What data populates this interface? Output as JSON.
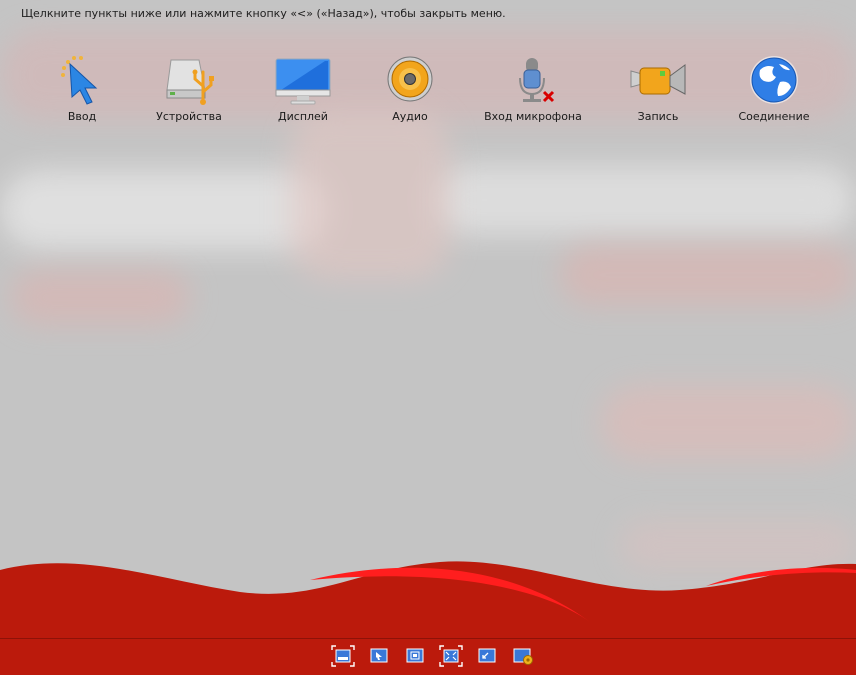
{
  "hint": "Щелкните пункты ниже или нажмите кнопку «<» («Назад»), чтобы закрыть меню.",
  "menu": {
    "items": [
      {
        "label": "Ввод",
        "icon": "pointer-cursor-icon"
      },
      {
        "label": "Устройства",
        "icon": "usb-drive-icon"
      },
      {
        "label": "Дисплей",
        "icon": "monitor-icon"
      },
      {
        "label": "Аудио",
        "icon": "speaker-icon"
      },
      {
        "label": "Вход микрофона",
        "icon": "microphone-muted-icon"
      },
      {
        "label": "Запись",
        "icon": "video-camera-icon"
      },
      {
        "label": "Соединение",
        "icon": "globe-icon"
      }
    ]
  },
  "taskbar": {
    "buttons": [
      {
        "icon": "window-mode-icon"
      },
      {
        "icon": "cursor-window-icon"
      },
      {
        "icon": "keyboard-window-icon"
      },
      {
        "icon": "fullscreen-icon"
      },
      {
        "icon": "minimize-window-icon"
      },
      {
        "icon": "settings-window-icon"
      }
    ]
  },
  "colors": {
    "accent_red": "#bb1a0c",
    "background": "#c4c4c4"
  }
}
